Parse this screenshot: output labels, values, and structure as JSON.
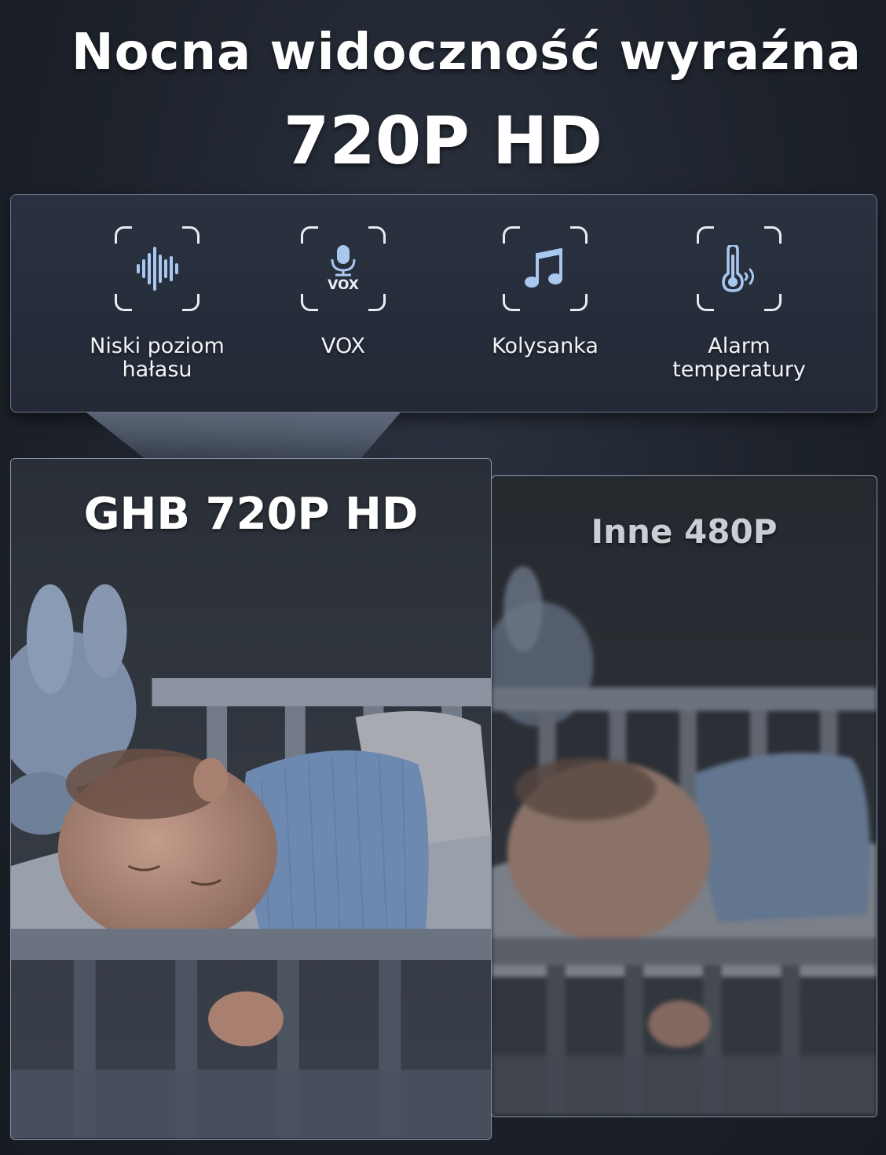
{
  "header": {
    "title": "Nocna widoczność wyraźna",
    "subtitle": "720P HD"
  },
  "features": [
    {
      "icon": "sound-wave-icon",
      "label": "Niski poziom\nhałasu"
    },
    {
      "icon": "vox-microphone-icon",
      "label": "VOX",
      "icon_text": "VOX"
    },
    {
      "icon": "music-note-icon",
      "label": "Kolysanka"
    },
    {
      "icon": "thermometer-icon",
      "label": "Alarm\ntemperatury"
    }
  ],
  "comparison": {
    "left_label": "GHB 720P HD",
    "right_label": "Inne 480P"
  },
  "colors": {
    "background": "#1d222b",
    "panel": "#262d39",
    "icon_blue": "#a9c8f0",
    "frame": "#e8ecf3"
  }
}
